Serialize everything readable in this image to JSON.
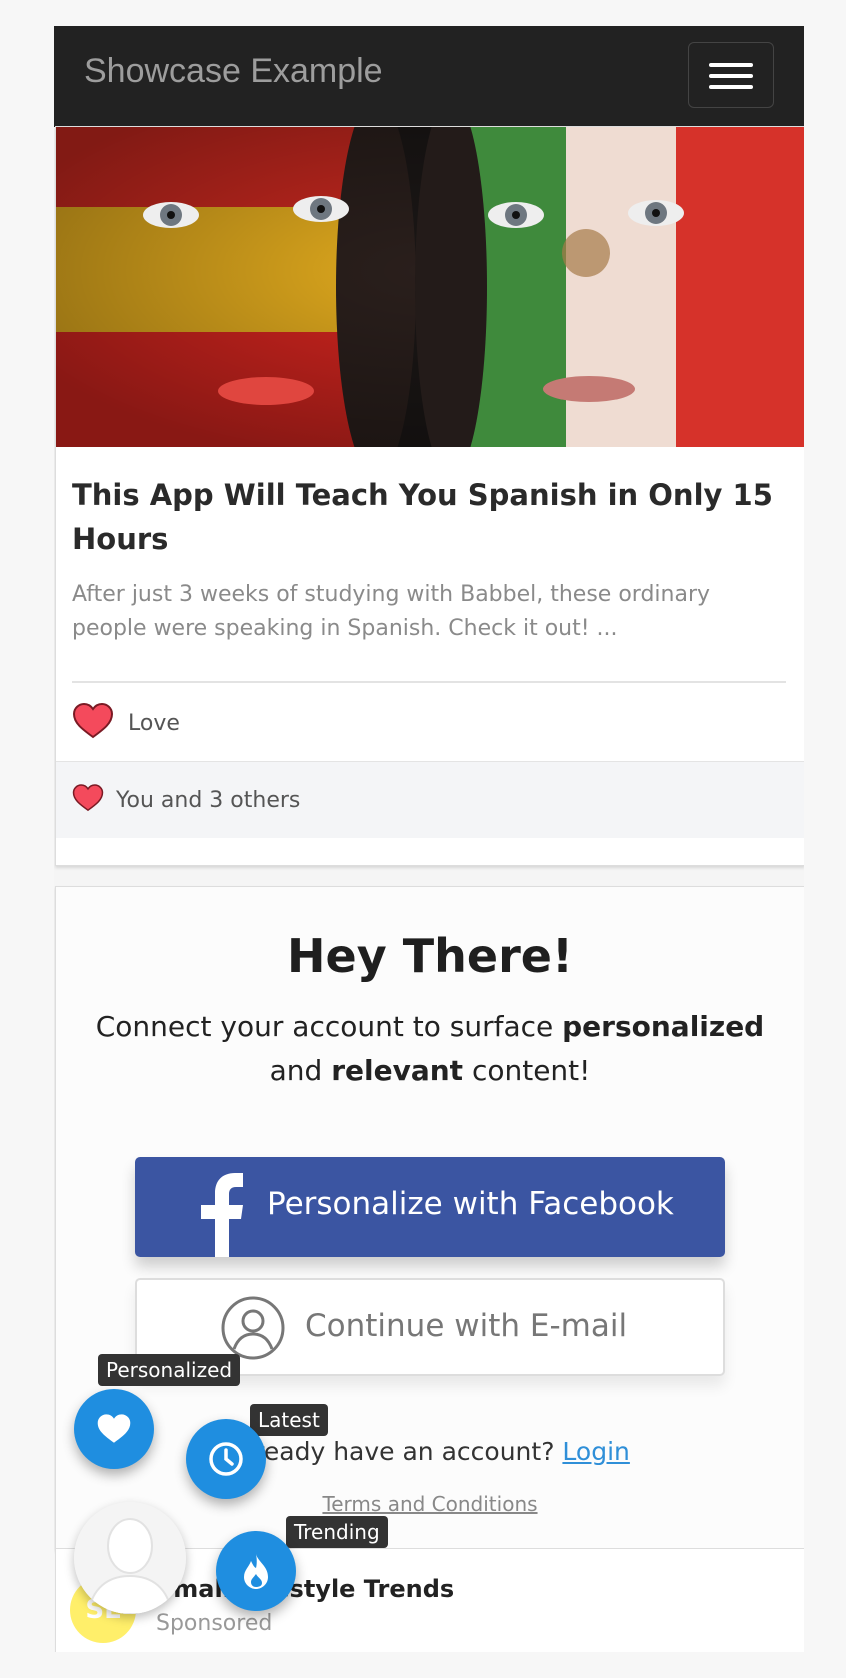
{
  "navbar": {
    "brand": "Showcase Example",
    "menu_icon": "hamburger-menu-icon"
  },
  "article": {
    "image": "spanish-mexican-flag-faces-photo",
    "title": "This App Will Teach You Spanish in Only 15 Hours",
    "excerpt": "After just 3 weeks of studying with Babbel, these ordinary people were speaking in Spanish. Check it out! ...",
    "reaction_label": "Love",
    "reaction_count_text": "You and 3 others",
    "heart_color": "#f44a5c"
  },
  "personalize": {
    "heading": "Hey There!",
    "text_1": "Connect your account to surface ",
    "text_bold_1": "personalized",
    "text_2": " and ",
    "text_bold_2": "relevant",
    "text_3": " content!",
    "facebook_button": "Personalize with Facebook",
    "email_button": "Continue with E-mail",
    "already_text": "Already have an account? ",
    "login_link": "Login",
    "terms_link": "Terms and Conditions",
    "facebook_color": "#3b55a2"
  },
  "sponsored": {
    "avatar_initials": "SL",
    "title": "Small Lifestyle Trends",
    "subtitle": "Sponsored"
  },
  "floating_menu": {
    "personalized": "Personalized",
    "latest": "Latest",
    "trending": "Trending",
    "accent": "#1f8ee0"
  }
}
